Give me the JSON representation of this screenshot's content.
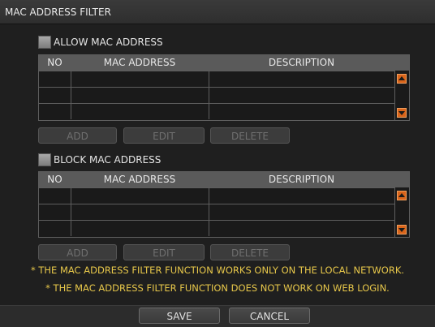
{
  "window": {
    "title": "MAC ADDRESS FILTER"
  },
  "allow": {
    "label": "ALLOW MAC ADDRESS",
    "columns": [
      "NO",
      "MAC ADDRESS",
      "DESCRIPTION"
    ],
    "buttons": {
      "add": "ADD",
      "edit": "EDIT",
      "delete": "DELETE"
    }
  },
  "block": {
    "label": "BLOCK MAC ADDRESS",
    "columns": [
      "NO",
      "MAC ADDRESS",
      "DESCRIPTION"
    ],
    "buttons": {
      "add": "ADD",
      "edit": "EDIT",
      "delete": "DELETE"
    }
  },
  "notices": [
    "* THE MAC ADDRESS FILTER FUNCTION WORKS ONLY ON THE LOCAL NETWORK.",
    "* THE MAC ADDRESS FILTER FUNCTION DOES NOT WORK ON WEB LOGIN."
  ],
  "footer": {
    "save": "SAVE",
    "cancel": "CANCEL"
  },
  "colors": {
    "accent": "#d9641a",
    "notice": "#e8c84a"
  },
  "icons": {
    "scroll_up": "arrow-up-icon",
    "scroll_down": "arrow-down-icon"
  }
}
